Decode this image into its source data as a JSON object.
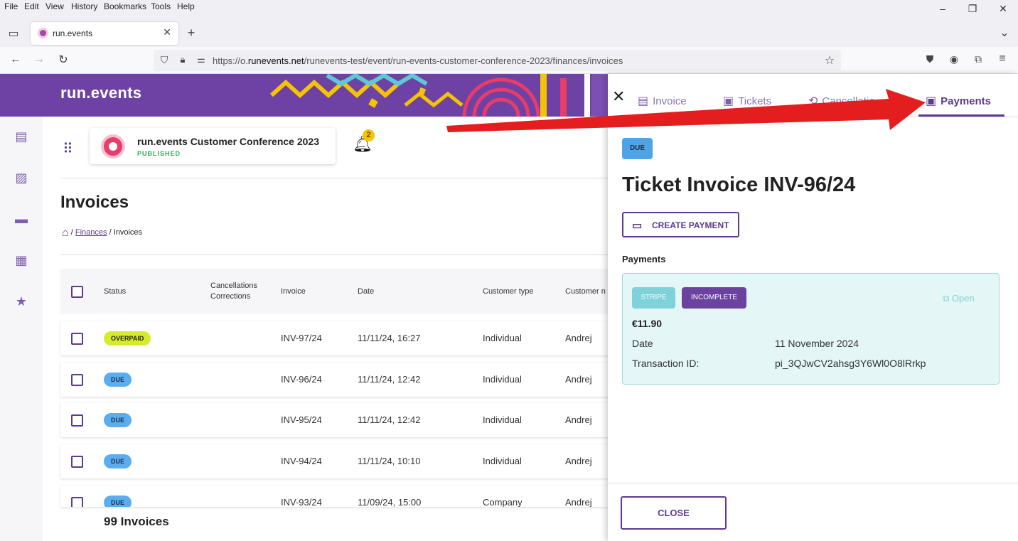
{
  "browser": {
    "menu": [
      "File",
      "Edit",
      "View",
      "History",
      "Bookmarks",
      "Tools",
      "Help"
    ],
    "tab_title": "run.events",
    "url_host": "https://o.",
    "url_domain": "runevents.net",
    "url_path": "/runevents-test/event/run-events-customer-conference-2023/finances/invoices"
  },
  "app": {
    "logo": "run.events",
    "event_name": "run.events Customer Conference 2023",
    "event_status": "PUBLISHED",
    "notification_count": "2",
    "page_title": "Invoices",
    "breadcrumb": {
      "link": "Finances",
      "sep": "/",
      "current": "Invoices"
    },
    "footer_count": "99 Invoices"
  },
  "table": {
    "headers": {
      "status": "Status",
      "cancellations_1": "Cancellations",
      "cancellations_2": "Corrections",
      "invoice": "Invoice",
      "date": "Date",
      "customer_type": "Customer type",
      "customer_name": "Customer n"
    },
    "rows": [
      {
        "status": "OVERPAID",
        "invoice": "INV-97/24",
        "date": "11/11/24, 16:27",
        "type": "Individual",
        "customer": "Andrej"
      },
      {
        "status": "DUE",
        "invoice": "INV-96/24",
        "date": "11/11/24, 12:42",
        "type": "Individual",
        "customer": "Andrej"
      },
      {
        "status": "DUE",
        "invoice": "INV-95/24",
        "date": "11/11/24, 12:42",
        "type": "Individual",
        "customer": "Andrej"
      },
      {
        "status": "DUE",
        "invoice": "INV-94/24",
        "date": "11/11/24, 10:10",
        "type": "Individual",
        "customer": "Andrej"
      },
      {
        "status": "DUE",
        "invoice": "INV-93/24",
        "date": "11/09/24, 15:00",
        "type": "Company",
        "customer": "Andrej"
      }
    ]
  },
  "drawer": {
    "tabs": {
      "invoice": "Invoice",
      "tickets": "Tickets",
      "cancellations": "Cancellatio",
      "payments": "Payments"
    },
    "status_chip": "DUE",
    "title": "Ticket Invoice INV-96/24",
    "create_payment": "CREATE PAYMENT",
    "payments_heading": "Payments",
    "payment": {
      "provider": "STRIPE",
      "state": "INCOMPLETE",
      "open": "Open",
      "amount": "€11.90",
      "date_label": "Date",
      "date_value": "11 November 2024",
      "txn_label": "Transaction ID:",
      "txn_value": "pi_3QJwCV2ahsg3Y6Wl0O8lRrkp"
    },
    "close": "CLOSE"
  },
  "colors": {
    "brand": "#5d3a91",
    "banner": "#6e42a4",
    "overpaid": "#d6ec2a",
    "due": "#5aaef0",
    "stripe": "#7fd2d9",
    "annotation_arrow": "#e41e1e"
  },
  "icons": {
    "tab_invoice": "receipt-icon",
    "tab_tickets": "ticket-icon",
    "tab_cancellations": "exchange-icon",
    "tab_payments": "payments-icon"
  }
}
